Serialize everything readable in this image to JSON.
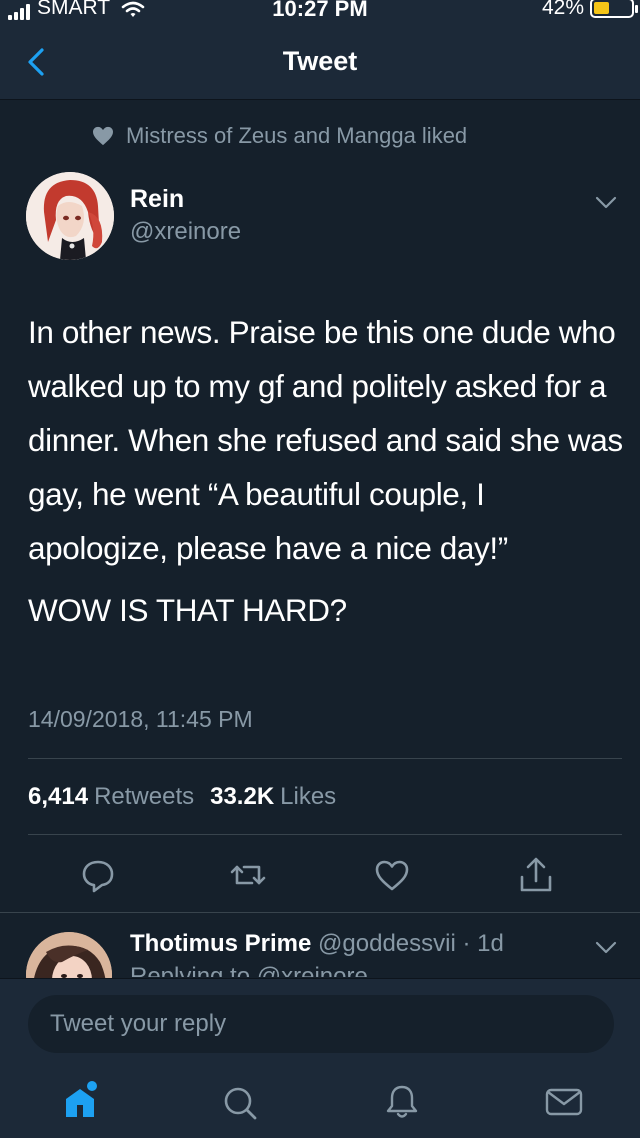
{
  "status_bar": {
    "carrier": "SMART",
    "time": "10:27 PM",
    "battery_percent_text": "42%",
    "battery_level": 0.42
  },
  "header": {
    "title": "Tweet",
    "back_icon": "chevron-left-icon"
  },
  "social_context": {
    "text": "Mistress of Zeus and Mangga liked",
    "icon": "heart-icon"
  },
  "tweet": {
    "author": {
      "name": "Rein",
      "handle": "@xreinore"
    },
    "paragraphs": [
      "In other news. Praise be this one dude who walked up to my gf and politely asked for a dinner. When she refused and said she was gay, he went “A beautiful couple, I apologize, please have a nice day!”",
      "WOW IS THAT HARD?"
    ],
    "timestamp": "14/09/2018, 11:45 PM",
    "stats": {
      "retweets_count": "6,414",
      "retweets_label": "Retweets",
      "likes_count": "33.2K",
      "likes_label": "Likes"
    },
    "actions": [
      "reply-icon",
      "retweet-icon",
      "like-icon",
      "share-icon"
    ]
  },
  "reply": {
    "name": "Thotimus Prime",
    "handle": "@goddessvii",
    "separator": " · ",
    "age": "1d",
    "context": "Replying to @xreinore"
  },
  "composer": {
    "placeholder": "Tweet your reply"
  },
  "tab_bar": [
    "home-icon",
    "search-icon",
    "notifications-icon",
    "messages-icon"
  ],
  "colors": {
    "background": "#15202b",
    "surface": "#1c2938",
    "accent": "#1da1f2",
    "secondary_text": "#8899a6",
    "battery": "#f5c518"
  }
}
